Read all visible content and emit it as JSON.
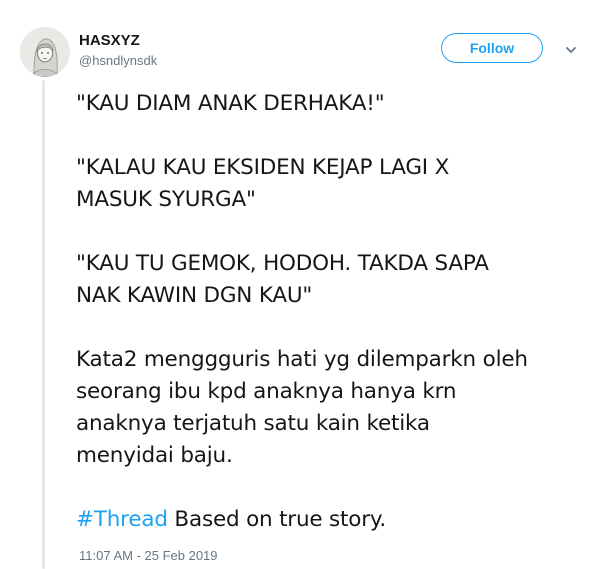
{
  "author": {
    "display_name": "HASXYZ",
    "username": "@hsndlynsdk",
    "avatar_icon": "profile-avatar-illustration"
  },
  "follow_button": {
    "label": "Follow"
  },
  "menu_icon": "chevron-down-icon",
  "tweet": {
    "paragraphs": [
      "\"KAU DIAM ANAK DERHAKA!\"",
      "\"KALAU KAU EKSIDEN KEJAP LAGI X\nMASUK SYURGA\"",
      "\"KAU TU GEMOK, HODOH. TAKDA SAPA\nNAK KAWIN DGN KAU\"",
      "Kata2 menggguris hati yg dilemparkn oleh\nseorang ibu kpd anaknya hanya krn\nanaknya terjatuh satu kain ketika\nmenyidai baju."
    ],
    "hashtag": "#Thread",
    "hashtag_trailing_text": " Based on true story.",
    "timestamp": "11:07 AM - 25 Feb 2019"
  },
  "colors": {
    "accent": "#1da1f2",
    "text": "#14171a",
    "secondary_text": "#657786",
    "thread_line": "#e1e8ed"
  }
}
